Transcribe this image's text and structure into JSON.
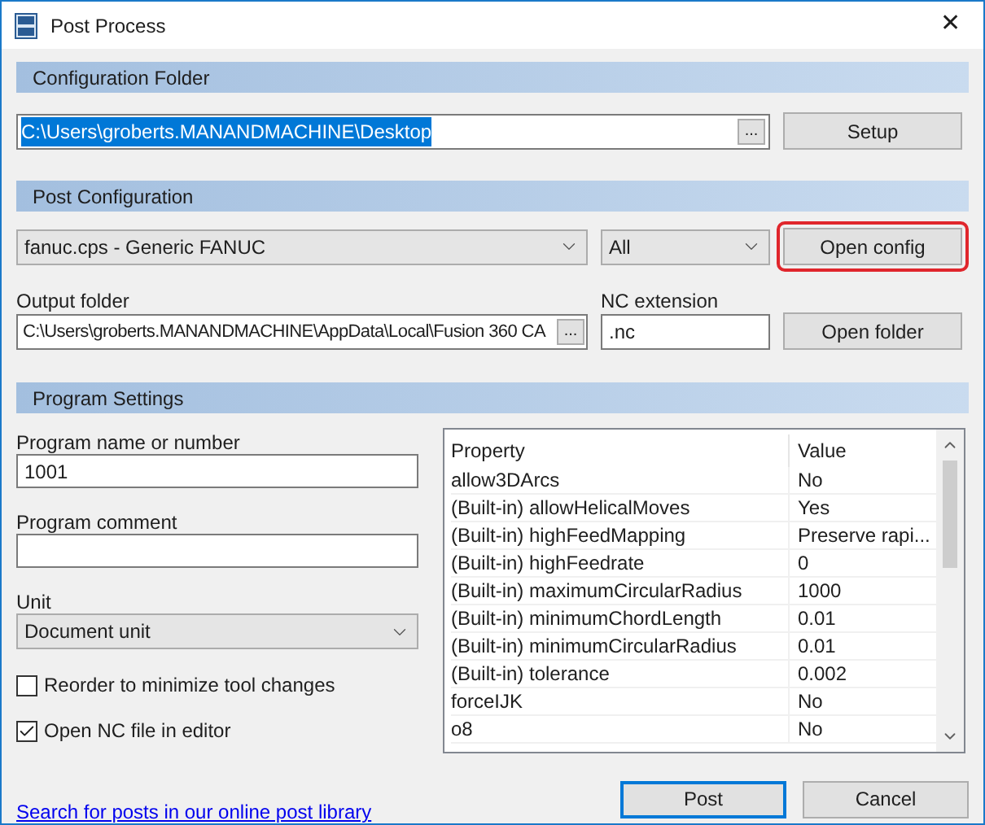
{
  "window": {
    "title": "Post Process",
    "close": "✕"
  },
  "configuration_folder": {
    "header": "Configuration Folder",
    "path": {
      "value": "C:\\Users\\groberts.MANANDMACHINE\\Desktop",
      "selected": true
    },
    "browse": "...",
    "setup": "Setup"
  },
  "post_configuration": {
    "header": "Post Configuration",
    "post": "fanuc.cps - Generic FANUC",
    "filter": "All",
    "open_config": {
      "label": "Open config",
      "highlighted": true
    },
    "output_folder": {
      "label": "Output folder",
      "value": "C:\\Users\\groberts.MANANDMACHINE\\AppData\\Local\\Fusion 360 CA",
      "browse": "..."
    },
    "nc_extension": {
      "label": "NC extension",
      "value": ".nc"
    },
    "open_folder": "Open folder"
  },
  "program_settings": {
    "header": "Program Settings",
    "program_name": {
      "label": "Program name or number",
      "value": "1001"
    },
    "program_comment": {
      "label": "Program comment"
    },
    "unit": {
      "label": "Unit",
      "value": "Document unit"
    },
    "options": [
      {
        "label": "Reorder to minimize tool changes",
        "checked": false
      },
      {
        "label": "Open NC file in editor",
        "checked": true
      }
    ],
    "table": {
      "columns": [
        "Property",
        "Value"
      ],
      "rows": [
        {
          "property": "allow3DArcs",
          "value": "No"
        },
        {
          "property": "(Built-in) allowHelicalMoves",
          "value": "Yes"
        },
        {
          "property": "(Built-in) highFeedMapping",
          "value": "Preserve rapi..."
        },
        {
          "property": "(Built-in) highFeedrate",
          "value": "0"
        },
        {
          "property": "(Built-in) maximumCircularRadius",
          "value": "1000"
        },
        {
          "property": "(Built-in) minimumChordLength",
          "value": "0.01"
        },
        {
          "property": "(Built-in) minimumCircularRadius",
          "value": "0.01"
        },
        {
          "property": "(Built-in) tolerance",
          "value": "0.002"
        },
        {
          "property": "forceIJK",
          "value": "No"
        },
        {
          "property": "o8",
          "value": "No"
        }
      ]
    }
  },
  "footer": {
    "link": "Search for posts in our online post library",
    "buttons": [
      {
        "label": "Post",
        "default": true
      },
      {
        "label": "Cancel",
        "default": false
      }
    ]
  }
}
